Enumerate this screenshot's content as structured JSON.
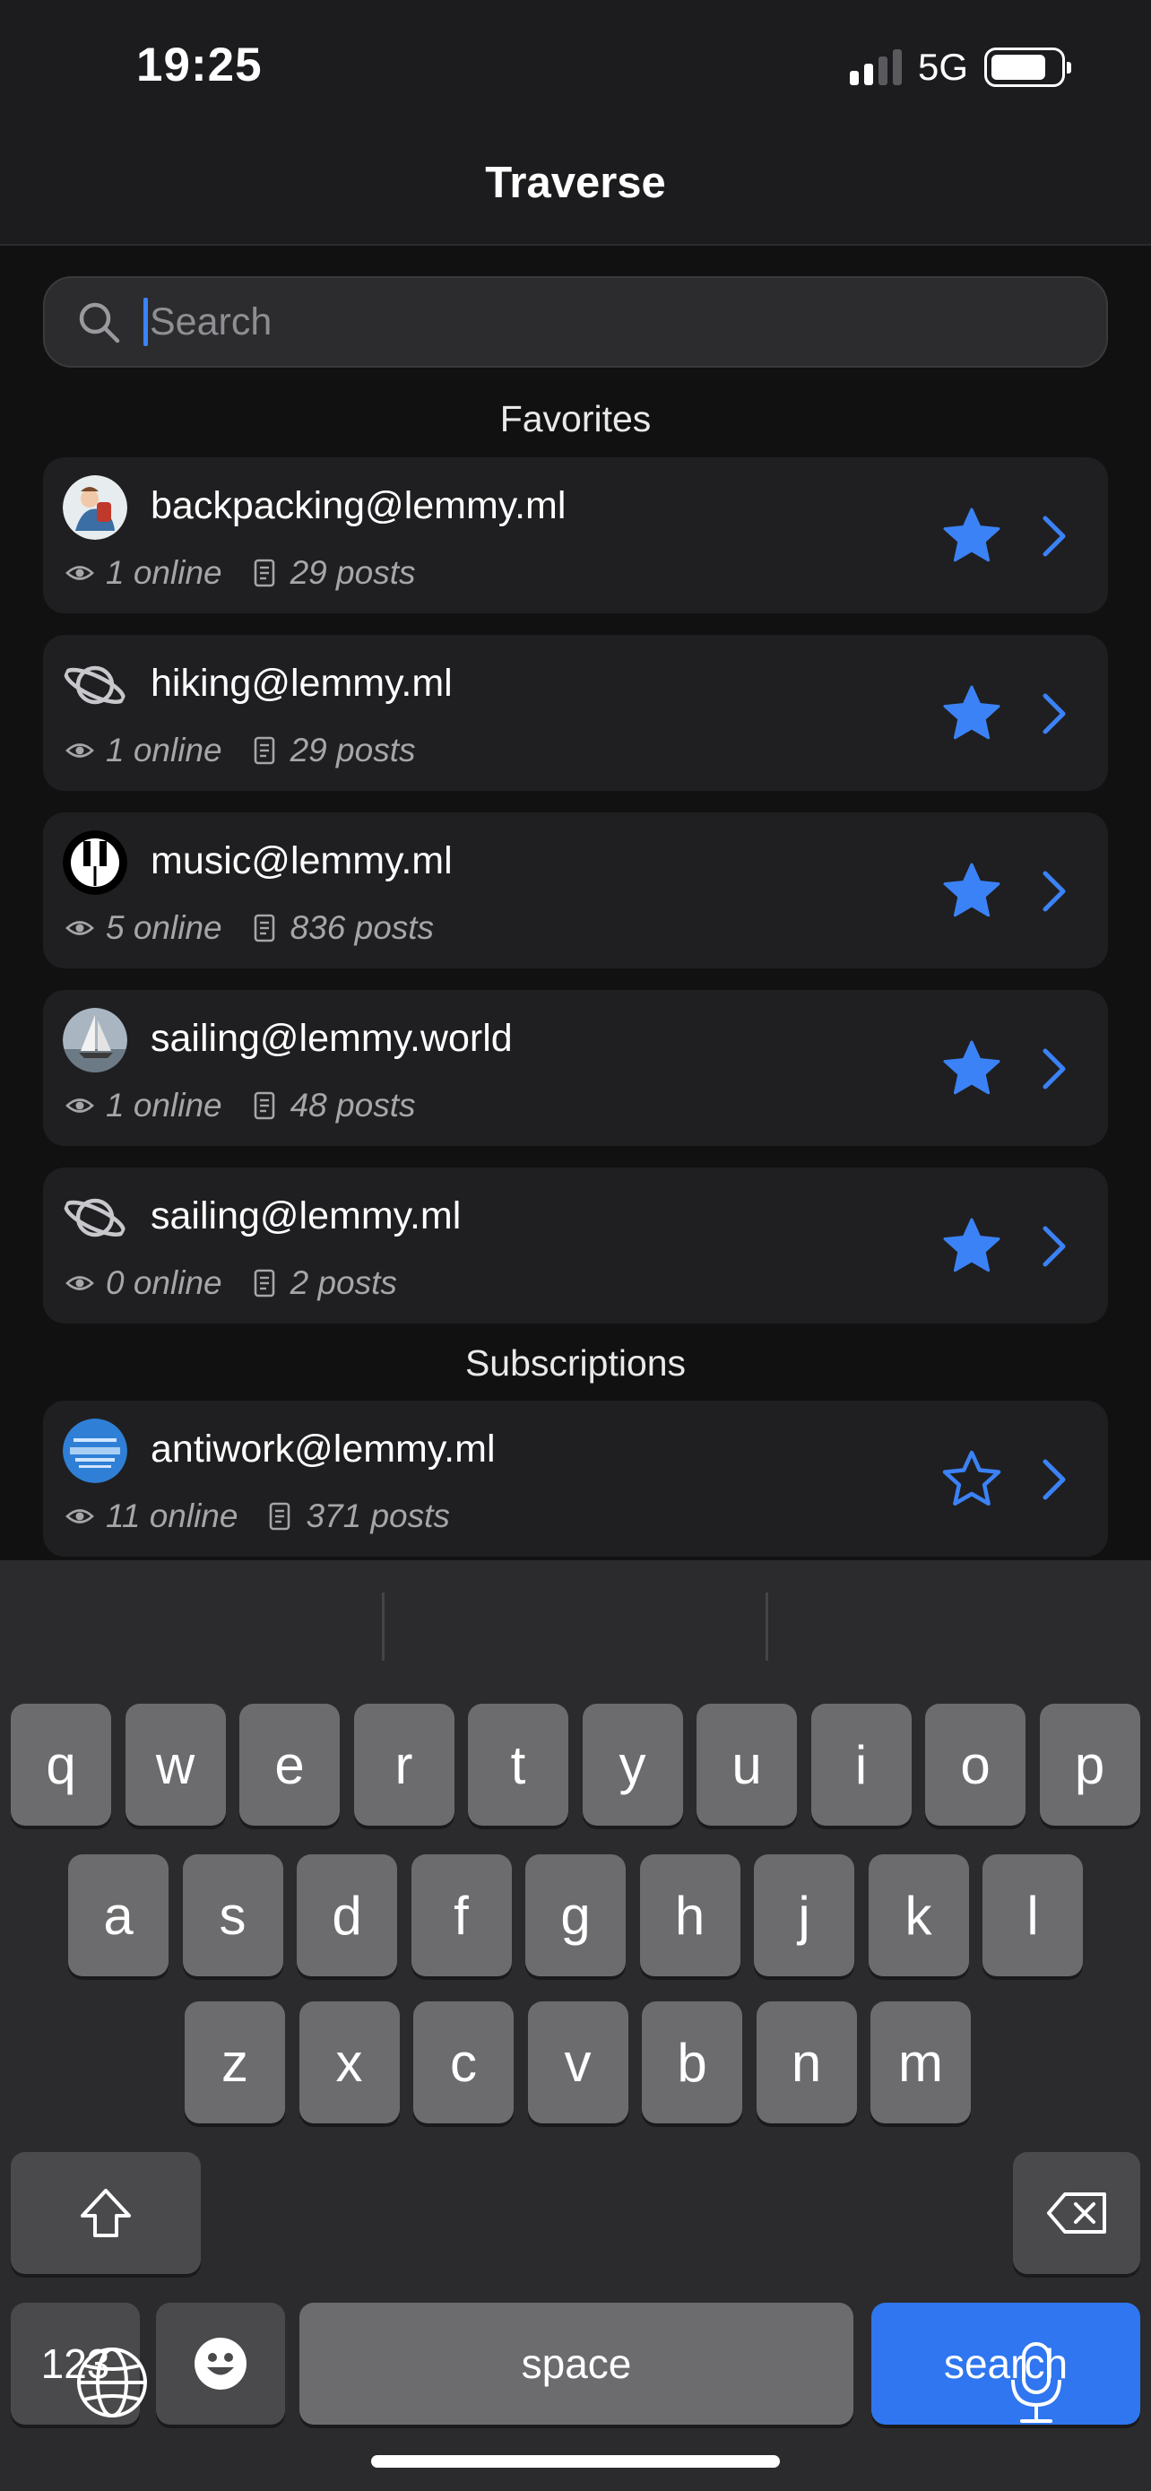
{
  "status_bar": {
    "time": "19:25",
    "network": "5G",
    "signal_bars": 2,
    "battery_level": 0.75
  },
  "nav": {
    "title": "Traverse"
  },
  "search": {
    "placeholder": "Search",
    "value": ""
  },
  "sections": {
    "favorites": "Favorites",
    "subscriptions": "Subscriptions"
  },
  "favorites": [
    {
      "name": "backpacking@lemmy.ml",
      "online": "1 online",
      "posts": "29 posts",
      "avatar": "backpacking-avatar",
      "starred": true
    },
    {
      "name": "hiking@lemmy.ml",
      "online": "1 online",
      "posts": "29 posts",
      "avatar": "planet-icon",
      "starred": true
    },
    {
      "name": "music@lemmy.ml",
      "online": "5 online",
      "posts": "836 posts",
      "avatar": "piano-keys-avatar",
      "starred": true
    },
    {
      "name": "sailing@lemmy.world",
      "online": "1 online",
      "posts": "48 posts",
      "avatar": "sailboat-avatar",
      "starred": true
    },
    {
      "name": "sailing@lemmy.ml",
      "online": "0 online",
      "posts": "2 posts",
      "avatar": "planet-icon",
      "starred": true
    }
  ],
  "subscriptions": [
    {
      "name": "antiwork@lemmy.ml",
      "online": "11 online",
      "posts": "371 posts",
      "avatar": "antiwork-avatar",
      "starred": false
    }
  ],
  "keyboard": {
    "row1": [
      "q",
      "w",
      "e",
      "r",
      "t",
      "y",
      "u",
      "i",
      "o",
      "p"
    ],
    "row2": [
      "a",
      "s",
      "d",
      "f",
      "g",
      "h",
      "j",
      "k",
      "l"
    ],
    "row3": [
      "z",
      "x",
      "c",
      "v",
      "b",
      "n",
      "m"
    ],
    "numbers_label": "123",
    "space_label": "space",
    "action_label": "search"
  },
  "colors": {
    "accent": "#3b82f6",
    "background": "#111112",
    "card": "#1f1f21",
    "keyboard": "#2b2b2d",
    "action_key": "#2f76f0"
  }
}
